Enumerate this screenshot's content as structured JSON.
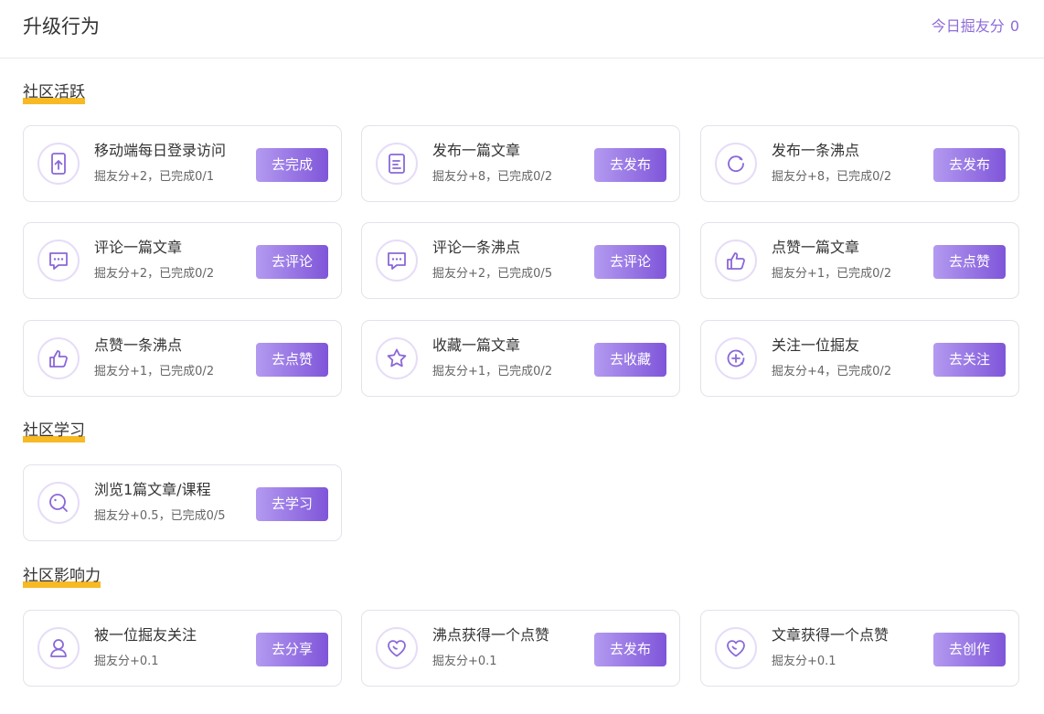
{
  "header": {
    "title": "升级行为",
    "score_label": "今日掘友分",
    "score_value": "0"
  },
  "sections": [
    {
      "title": "社区活跃",
      "cards": [
        {
          "icon": "phone-login-icon",
          "title": "移动端每日登录访问",
          "desc": "掘友分+2，已完成0/1",
          "button": "去完成"
        },
        {
          "icon": "article-icon",
          "title": "发布一篇文章",
          "desc": "掘友分+8，已完成0/2",
          "button": "去发布"
        },
        {
          "icon": "pin-icon",
          "title": "发布一条沸点",
          "desc": "掘友分+8，已完成0/2",
          "button": "去发布"
        },
        {
          "icon": "comment-icon",
          "title": "评论一篇文章",
          "desc": "掘友分+2，已完成0/2",
          "button": "去评论"
        },
        {
          "icon": "comment-icon",
          "title": "评论一条沸点",
          "desc": "掘友分+2，已完成0/5",
          "button": "去评论"
        },
        {
          "icon": "thumbs-up-icon",
          "title": "点赞一篇文章",
          "desc": "掘友分+1，已完成0/2",
          "button": "去点赞"
        },
        {
          "icon": "thumbs-up-icon",
          "title": "点赞一条沸点",
          "desc": "掘友分+1，已完成0/2",
          "button": "去点赞"
        },
        {
          "icon": "star-icon",
          "title": "收藏一篇文章",
          "desc": "掘友分+1，已完成0/2",
          "button": "去收藏"
        },
        {
          "icon": "follow-icon",
          "title": "关注一位掘友",
          "desc": "掘友分+4，已完成0/2",
          "button": "去关注"
        }
      ]
    },
    {
      "title": "社区学习",
      "cards": [
        {
          "icon": "browse-icon",
          "title": "浏览1篇文章/课程",
          "desc": "掘友分+0.5，已完成0/5",
          "button": "去学习"
        }
      ]
    },
    {
      "title": "社区影响力",
      "cards": [
        {
          "icon": "user-icon",
          "title": "被一位掘友关注",
          "desc": "掘友分+0.1",
          "button": "去分享"
        },
        {
          "icon": "heart-icon",
          "title": "沸点获得一个点赞",
          "desc": "掘友分+0.1",
          "button": "去发布"
        },
        {
          "icon": "heart-icon",
          "title": "文章获得一个点赞",
          "desc": "掘友分+0.1",
          "button": "去创作"
        }
      ]
    }
  ],
  "colors": {
    "accent": "#8e6ad8",
    "button_start": "#b39af0",
    "button_end": "#7f55d9",
    "underline": "#f7b924",
    "icon_ring": "#e6dcf8"
  }
}
